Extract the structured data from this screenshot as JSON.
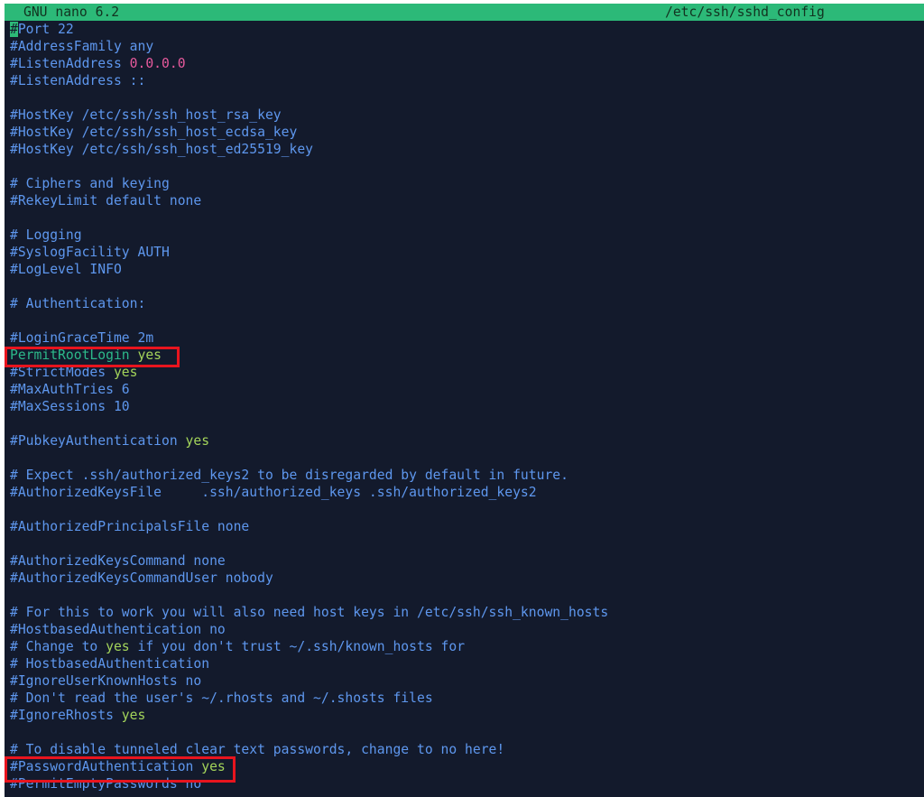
{
  "editor": {
    "app_title": "GNU nano 6.2",
    "file_path": "/etc/ssh/sshd_config"
  },
  "lines": {
    "port_hash": "#",
    "port_text": "Port 22",
    "address_family": "#AddressFamily any",
    "listen_address_1_key": "#ListenAddress ",
    "listen_address_1_value": "0.0.0.0",
    "listen_address_2": "#ListenAddress ::",
    "hostkey_rsa": "#HostKey /etc/ssh/ssh_host_rsa_key",
    "hostkey_ecdsa": "#HostKey /etc/ssh/ssh_host_ecdsa_key",
    "hostkey_ed25519": "#HostKey /etc/ssh/ssh_host_ed25519_key",
    "ciphers_comment": "# Ciphers and keying",
    "rekey_limit": "#RekeyLimit default none",
    "logging_comment": "# Logging",
    "syslog_facility": "#SyslogFacility AUTH",
    "log_level": "#LogLevel INFO",
    "authentication_comment": "# Authentication:",
    "login_grace_time": "#LoginGraceTime 2m",
    "permit_root_login_key": "PermitRootLogin ",
    "permit_root_login_value": "yes",
    "strict_modes_key": "#StrictModes ",
    "strict_modes_value": "yes",
    "max_auth_tries": "#MaxAuthTries 6",
    "max_sessions": "#MaxSessions 10",
    "pubkey_auth_key": "#PubkeyAuthentication ",
    "pubkey_auth_value": "yes",
    "expect_comment": "# Expect .ssh/authorized_keys2 to be disregarded by default in future.",
    "authorized_keys_file": "#AuthorizedKeysFile     .ssh/authorized_keys .ssh/authorized_keys2",
    "authorized_principals_file": "#AuthorizedPrincipalsFile none",
    "authorized_keys_command": "#AuthorizedKeysCommand none",
    "authorized_keys_command_user": "#AuthorizedKeysCommandUser nobody",
    "for_this_comment": "# For this to work you will also need host keys in /etc/ssh/ssh_known_hosts",
    "hostbased_auth": "#HostbasedAuthentication no",
    "change_to_part1": "# Change to ",
    "change_to_yes": "yes",
    "change_to_part2": " if you don't trust ~/.ssh/known_hosts for",
    "hostbased_auth_comment": "# HostbasedAuthentication",
    "ignore_user_known_hosts": "#IgnoreUserKnownHosts no",
    "dont_read_comment": "# Don't read the user's ~/.rhosts and ~/.shosts files",
    "ignore_rhosts_key": "#IgnoreRhosts ",
    "ignore_rhosts_value": "yes",
    "disable_tunneled_comment": "# To disable tunneled clear text passwords, change to no here!",
    "password_auth_key": "#PasswordAuthentication ",
    "password_auth_value": "yes",
    "permit_empty_passwords": "#PermitEmptyPasswords no"
  },
  "colors": {
    "background": "#131a2c",
    "titlebar": "#2cb978",
    "comment": "#5e97ee",
    "keyword": "#2cb98a",
    "value_yes": "#a3d45a",
    "number": "#e85a9d",
    "highlight_box": "#e8141e"
  }
}
